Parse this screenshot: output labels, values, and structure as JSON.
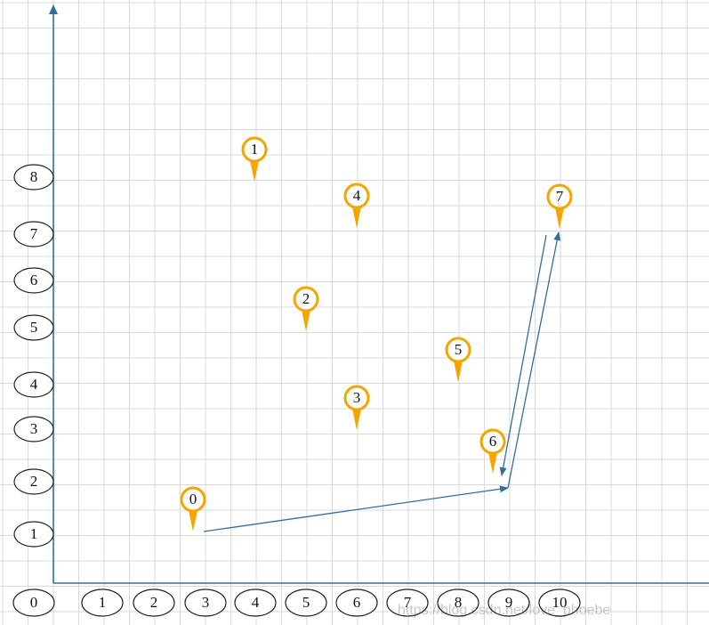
{
  "x_ticks": [
    {
      "label": "0",
      "value": 0
    },
    {
      "label": "1",
      "value": 1
    },
    {
      "label": "2",
      "value": 2
    },
    {
      "label": "3",
      "value": 3
    },
    {
      "label": "4",
      "value": 4
    },
    {
      "label": "5",
      "value": 5
    },
    {
      "label": "6",
      "value": 6
    },
    {
      "label": "7",
      "value": 7
    },
    {
      "label": "8",
      "value": 8
    },
    {
      "label": "9",
      "value": 9
    },
    {
      "label": "10",
      "value": 10
    }
  ],
  "y_ticks": [
    {
      "label": "1",
      "value": 1
    },
    {
      "label": "2",
      "value": 2
    },
    {
      "label": "3",
      "value": 3
    },
    {
      "label": "4",
      "value": 4
    },
    {
      "label": "5",
      "value": 5
    },
    {
      "label": "6",
      "value": 6
    },
    {
      "label": "7",
      "value": 7
    },
    {
      "label": "8",
      "value": 8
    }
  ],
  "points": [
    {
      "label": "0",
      "x": 3,
      "y": 1
    },
    {
      "label": "1",
      "x": 4,
      "y": 8
    },
    {
      "label": "2",
      "x": 5,
      "y": 5.5
    },
    {
      "label": "3",
      "x": 6,
      "y": 3.2
    },
    {
      "label": "4",
      "x": 6,
      "y": 7.1
    },
    {
      "label": "5",
      "x": 8,
      "y": 4.5
    },
    {
      "label": "6",
      "x": 8.7,
      "y": 2.2
    },
    {
      "label": "7",
      "x": 10,
      "y": 7.2
    }
  ],
  "path_points": [
    {
      "x": 3,
      "y": 1
    },
    {
      "x": 9,
      "y": 1.95
    },
    {
      "x": 10,
      "y": 7.2
    }
  ],
  "return_path": [
    {
      "x": 9.8,
      "y": 7.2
    },
    {
      "x": 8.9,
      "y": 2.2
    }
  ],
  "watermark": "https://blog.csdn.net/love_phoebe",
  "colors": {
    "marker": "#f5a400",
    "axis": "#2e6f9e",
    "grid": "#d9d9d9"
  }
}
